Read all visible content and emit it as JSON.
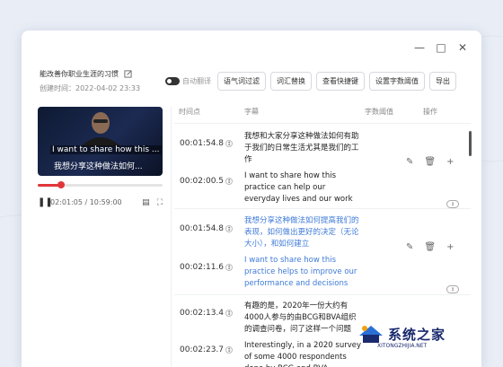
{
  "window": {
    "project_title": "能改善你职业生涯的习惯",
    "created_label": "创建时间：2022-04-02 23:33"
  },
  "toolbar": {
    "auto_translate_label": "自动翻译",
    "buttons": [
      "语气词过滤",
      "词汇替换",
      "查看快捷键",
      "设置字数阈值",
      "导出"
    ]
  },
  "player": {
    "subtitle_en": "I want to share how this ...",
    "subtitle_cn": "我想分享这种做法如何...",
    "time_text": "02:01:05 / 10:59:00",
    "progress": 0.19
  },
  "table": {
    "headers": [
      "时间点",
      "字幕",
      "字数阈值",
      "操作"
    ],
    "rows": [
      {
        "start": "00:01:54.8",
        "end": "00:02:00.5",
        "cn": "我想和大家分享这种做法如何有助于我们的日常生活尤其是我们的工作",
        "en": "I want to share how this practice can help our everyday lives and our work",
        "highlight": false
      },
      {
        "start": "00:01:54.8",
        "end": "00:02:11.6",
        "cn": "我想分享这种做法如何提高我们的表现，如何做出更好的决定（无论大小），和如何建立",
        "en": "I want to share how this practice helps to improve our performance and decisions",
        "highlight": true
      },
      {
        "start": "00:02:13.4",
        "end": "00:02:23.7",
        "cn": "有趣的是，2020年一份大约有4000人参与的由BCG和BVA组织的调查问卷，问了这样一个问题",
        "en": "Interestingly, in a 2020 survey of some 4000 respondents done by BCG and BVA",
        "highlight": false
      }
    ]
  },
  "watermark": {
    "text": "系统之家",
    "url": "XITONGZHIJIA.NET"
  },
  "colors": {
    "accent_red": "#e0363a",
    "highlight_blue": "#3f7bd8"
  }
}
